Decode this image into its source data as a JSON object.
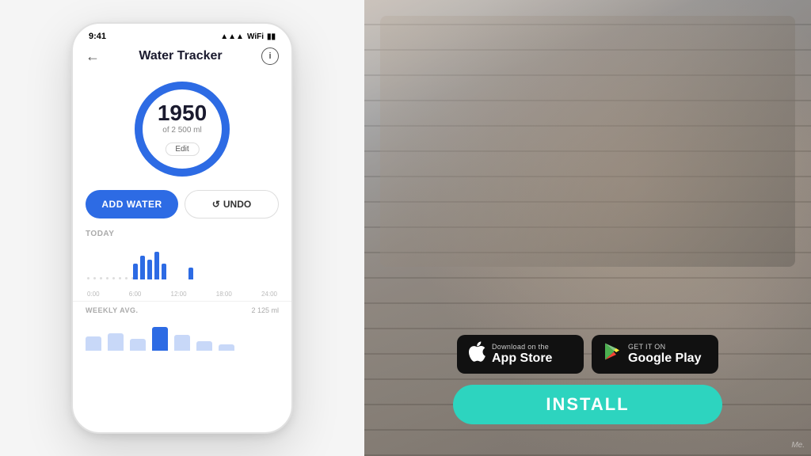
{
  "phone": {
    "status_time": "9:41",
    "signal_icon": "▲▲▲",
    "wifi_icon": "WiFi",
    "battery_icon": "▮",
    "back_arrow": "←",
    "title": "Water Tracker",
    "info_icon": "i",
    "water_value": "1950",
    "water_sub": "of 2 500 ml",
    "edit_label": "Edit",
    "add_water_label": "ADD WATER",
    "undo_icon": "↺",
    "undo_label": "UNDO",
    "today_label": "TODAY",
    "time_labels": [
      "0:00",
      "6:00",
      "12:00",
      "18:00",
      "24:00"
    ],
    "weekly_label": "WEEKLY AVG.",
    "weekly_value": "2 125 ml"
  },
  "app_store": {
    "top_text": "Download on the",
    "bottom_text": "App Store"
  },
  "google_play": {
    "top_text": "GET IT ON",
    "bottom_text": "Google Play"
  },
  "install_label": "INSTALL",
  "watermark": "Me."
}
